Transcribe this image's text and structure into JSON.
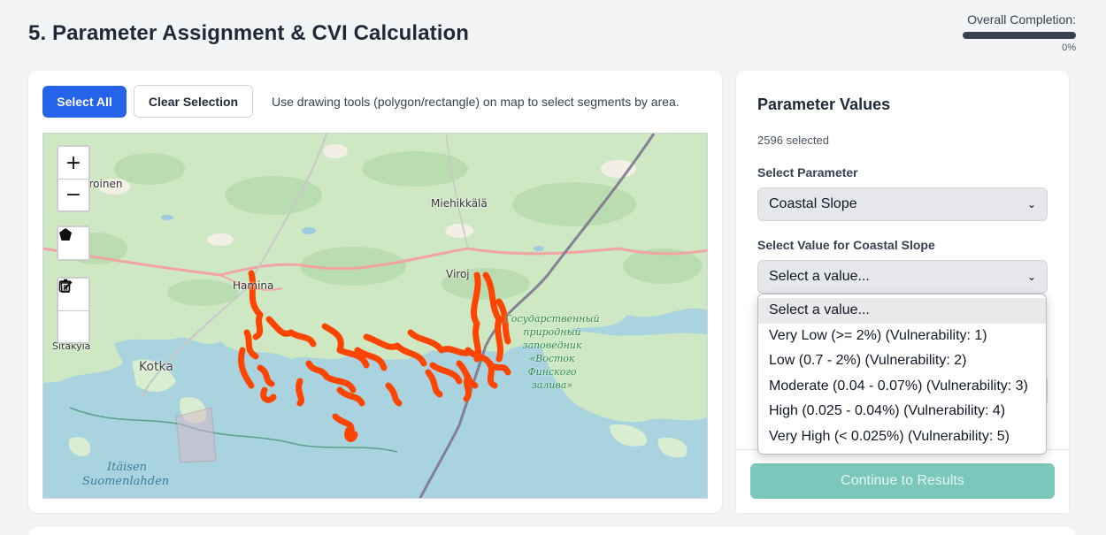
{
  "page": {
    "title": "5. Parameter Assignment & CVI Calculation"
  },
  "completion": {
    "label": "Overall Completion:",
    "percent_text": "0%",
    "progress_fraction": 0,
    "track_color": "#374151"
  },
  "toolbar": {
    "select_all_label": "Select All",
    "clear_selection_label": "Clear Selection",
    "hint": "Use drawing tools (polygon/rectangle) on map to select segments by area."
  },
  "map": {
    "controls": {
      "zoom_in": "+",
      "zoom_out": "−",
      "polygon_icon": "pentagon-icon",
      "edit_icon": "edit-icon",
      "delete_icon": "trash-icon"
    },
    "labels": {
      "town_nw": "nkeroinen",
      "miehikkala": "Miehikkälä",
      "hamina": "Hamina",
      "virojoki": "Viroj",
      "sitakyla": "Sitakylä",
      "kotka": "Kotka",
      "sea_line1": "Itäisen",
      "sea_line2": "Suomenlahden",
      "reserve_line1": "Государственный",
      "reserve_line2": "природный",
      "reserve_line3": "заповедник",
      "reserve_line4": "«Восток",
      "reserve_line5": "Финского",
      "reserve_line6": "залива»"
    },
    "colors": {
      "land": "#cfe8c4",
      "water": "#a9d3df",
      "segments": "#ff4500",
      "road": "#f2a3a3",
      "border": "#7a6f8a"
    }
  },
  "panel": {
    "title": "Parameter Values",
    "selected_count": "2596 selected",
    "parameter_label": "Select Parameter",
    "parameter_value": "Coastal Slope",
    "value_label": "Select Value for Coastal Slope",
    "value_placeholder": "Select a value...",
    "options": [
      "Select a value...",
      "Very Low (>= 2%) (Vulnerability: 1)",
      "Low (0.7 - 2%) (Vulnerability: 2)",
      "Moderate (0.04 - 0.07%) (Vulnerability: 3)",
      "High (0.025 - 0.04%) (Vulnerability: 4)",
      "Very High (< 0.025%) (Vulnerability: 5)"
    ],
    "continue_label": "Continue to Results"
  }
}
